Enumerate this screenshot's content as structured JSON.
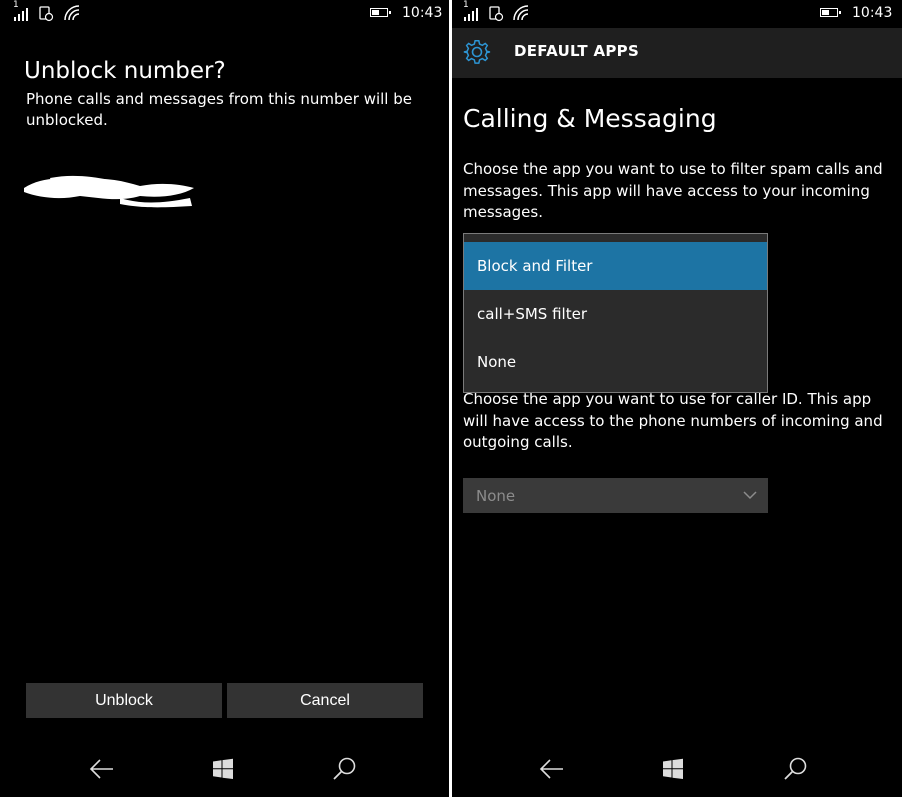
{
  "left": {
    "status": {
      "time": "10:43",
      "signal_label": "1"
    },
    "dialog": {
      "title": "Unblock number?",
      "message": "Phone calls and messages from this number will be unblocked."
    },
    "buttons": {
      "unblock": "Unblock",
      "cancel": "Cancel"
    },
    "navbar": {
      "icons": [
        "back-arrow-icon",
        "windows-logo-icon",
        "search-icon"
      ]
    }
  },
  "right": {
    "status": {
      "time": "10:43",
      "signal_label": "1"
    },
    "header": {
      "title": "DEFAULT APPS",
      "icon": "gear-icon",
      "accent": "#2d95d4"
    },
    "page_title": "Calling & Messaging",
    "spam_description": "Choose the app you want to use to filter spam calls and messages. This app will have access to your incoming messages.",
    "spam_dropdown": {
      "options": [
        "Block and Filter",
        "call+SMS filter",
        "None"
      ],
      "selected": "Block and Filter",
      "selected_color": "#1d74a4"
    },
    "callerid_description": "Choose the app you want to use for caller ID. This app will have access to the phone numbers of incoming and outgoing calls.",
    "callerid_dropdown": {
      "value": "None"
    },
    "navbar": {
      "icons": [
        "back-arrow-icon",
        "windows-logo-icon",
        "search-icon"
      ]
    }
  }
}
